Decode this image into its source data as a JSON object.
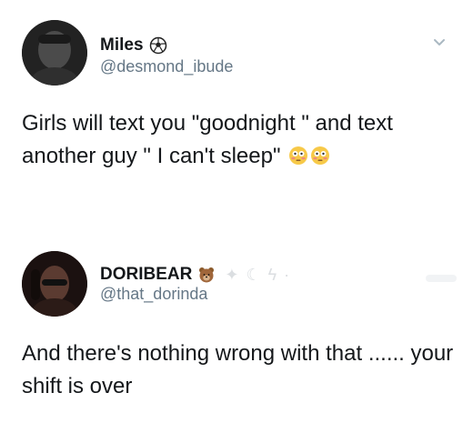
{
  "tweets": [
    {
      "name": "Miles",
      "handle": "@desmond_ibude",
      "text": "Girls will text you \"goodnight \" and text another guy \" I can't sleep\"",
      "name_icon": "soccer-ball-icon",
      "text_emojis": [
        "flushed-face-icon",
        "flushed-face-icon"
      ]
    },
    {
      "name": "DORIBEAR",
      "handle": "@that_dorinda",
      "text": "And there's nothing wrong with that ...... your shift is over",
      "name_icons": [
        "bear-face-icon",
        "sparkle-icon",
        "crescent-moon-icon",
        "lightning-icon",
        "faint-star-icon"
      ]
    }
  ],
  "colors": {
    "text": "#14171a",
    "secondary": "#657786",
    "background": "#ffffff"
  }
}
